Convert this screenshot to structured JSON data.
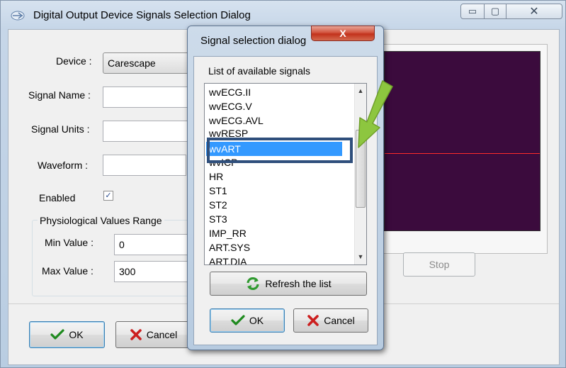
{
  "main_window": {
    "title": "Digital Output Device Signals Selection Dialog",
    "controls": {
      "minimize": "▭",
      "maximize": "▢",
      "close": "✕"
    },
    "device": {
      "label": "Device :",
      "value": "Carescape"
    },
    "signal_name": {
      "label": "Signal Name :",
      "value": ""
    },
    "signal_units": {
      "label": "Signal Units :",
      "value": ""
    },
    "waveform": {
      "label": "Waveform :",
      "value": ""
    },
    "enabled": {
      "label": "Enabled",
      "checked": true,
      "mark": "✓"
    },
    "range_group": {
      "title": "Physiological Values Range",
      "min": {
        "label": "Min Value :",
        "value": "0"
      },
      "max": {
        "label": "Max Value :",
        "value": "300"
      }
    },
    "stop_label": "Stop",
    "ok_label": "OK",
    "cancel_label": "Cancel"
  },
  "signal_dialog": {
    "title": "Signal selection dialog",
    "close_label": "X",
    "list_label": "List of available signals",
    "signals": [
      "wvECG.II",
      "wvECG.V",
      "wvECG.AVL",
      "wvRESP",
      "wvART",
      "wvICP",
      "HR",
      "ST1",
      "ST2",
      "ST3",
      "IMP_RR",
      "ART.SYS",
      "ART.DIA"
    ],
    "selected_signal": "wvART",
    "refresh_label": "Refresh the list",
    "ok_label": "OK",
    "cancel_label": "Cancel"
  },
  "colors": {
    "plot_background": "#3b0b3d",
    "trace": "#ff2a2a",
    "selection": "#3399ff",
    "annotation_arrow": "#8dc63f",
    "annotation_box": "#2f4f7c"
  }
}
